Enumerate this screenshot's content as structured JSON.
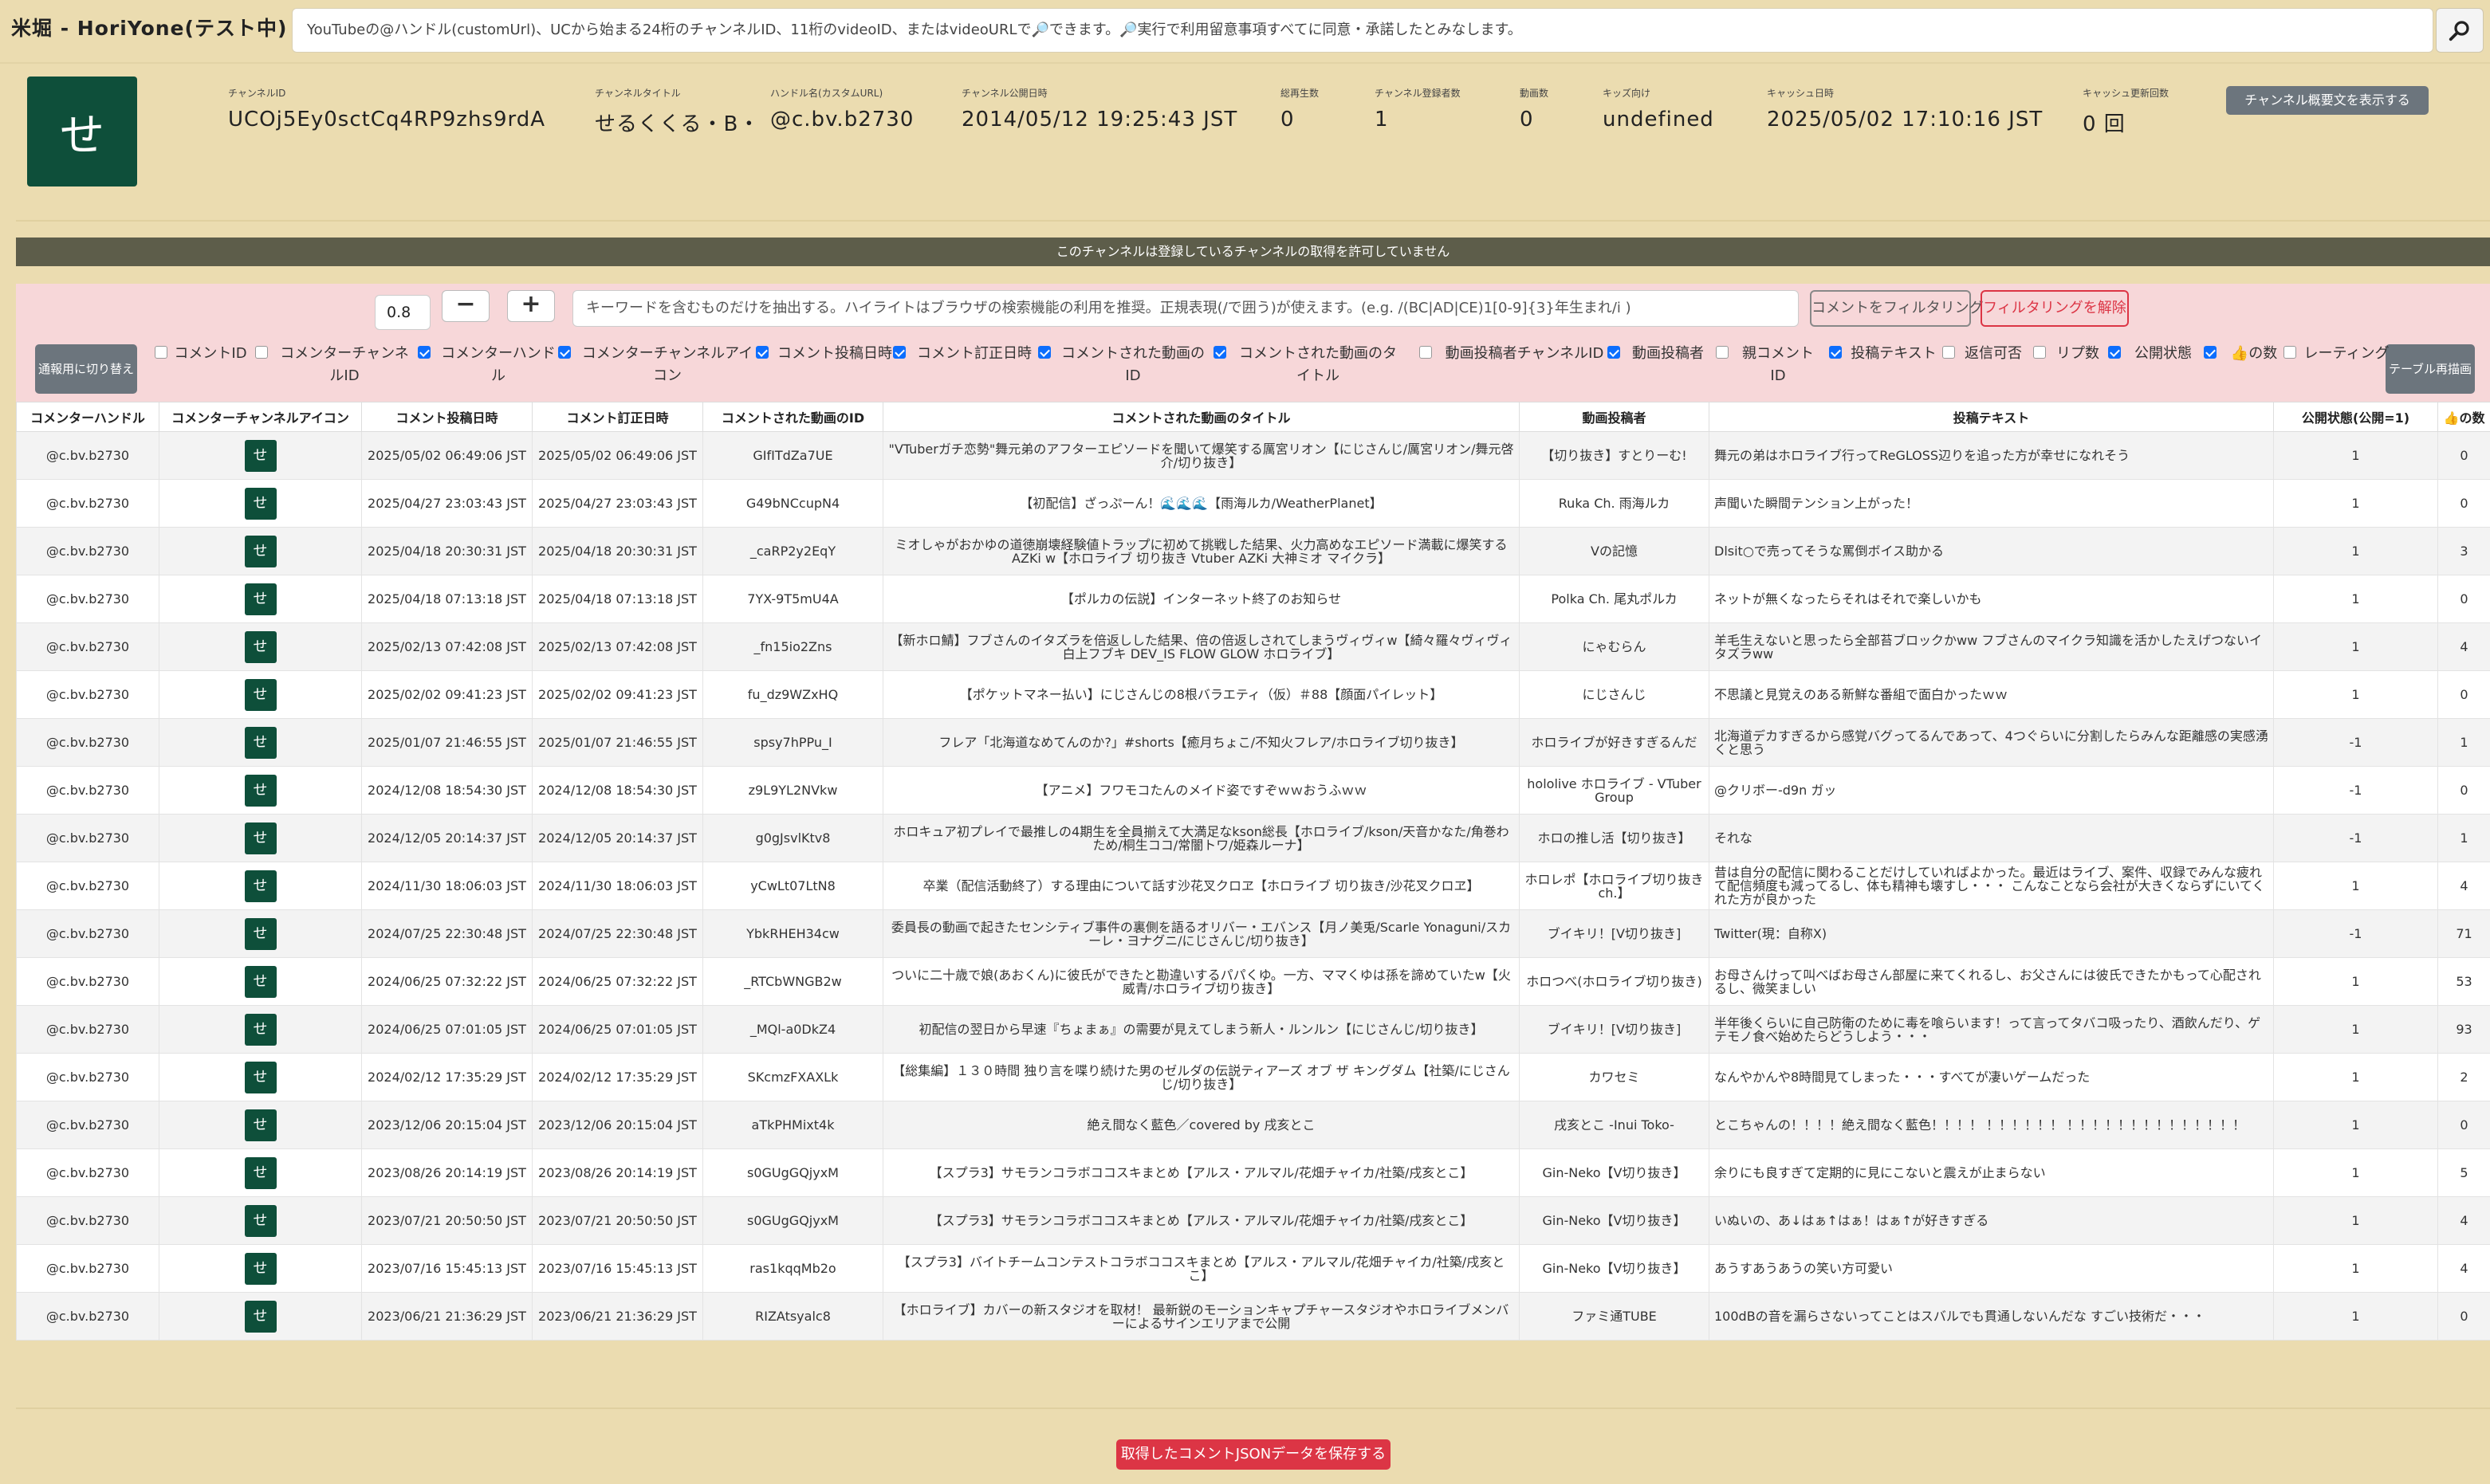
{
  "app": {
    "title": "米堀 - HoriYone(テスト中)",
    "search_placeholder": "YouTubeの@ハンドル(customUrl)、UCから始まる24桁のチャンネルID、11桁のvideoID、またはvideoURLで🔎できます。🔎実行で利用留意事項すべてに同意・承諾したとみなします。"
  },
  "channel": {
    "avatar_char": "せ",
    "fields": [
      {
        "label": "チャンネルID",
        "value": "UCOj5Ey0sctCq4RP9zhs9rdA"
      },
      {
        "label": "チャンネルタイトル",
        "value": "せるくくる・B・"
      },
      {
        "label": "ハンドル名(カスタムURL)",
        "value": "@c.bv.b2730"
      },
      {
        "label": "チャンネル公開日時",
        "value": "2014/05/12 19:25:43 JST"
      },
      {
        "label": "総再生数",
        "value": "0"
      },
      {
        "label": "チャンネル登録者数",
        "value": "1"
      },
      {
        "label": "動画数",
        "value": "0"
      },
      {
        "label": "キッズ向け",
        "value": "undefined"
      },
      {
        "label": "キャッシュ日時",
        "value": "2025/05/02 17:10:16 JST"
      },
      {
        "label": "キャッシュ更新回数",
        "value": "0 回"
      }
    ],
    "show_description_button": "チャンネル概要文を表示する"
  },
  "notice": "このチャンネルは登録しているチャンネルの取得を許可していません",
  "filter": {
    "opacity_value": "0.8",
    "minus": "−",
    "plus": "+",
    "keyword_placeholder": "キーワードを含むものだけを抽出する。ハイライトはブラウザの検索機能の利用を推奨。正規表現(/で囲う)が使えます。(e.g. /(BC|AD|CE)1[0-9]{3}年生まれ/i )",
    "filter_button": "コメントをフィルタリング",
    "unfilter_button": "フィルタリングを解除",
    "toggle_button": "通報用に切り替え",
    "redraw_button": "テーブル再描画",
    "columns": [
      {
        "label": "コメントID",
        "checked": false
      },
      {
        "label": "コメンターチャンネルID",
        "checked": false
      },
      {
        "label": "コメンターハンドル",
        "checked": true
      },
      {
        "label": "コメンターチャンネルアイコン",
        "checked": true
      },
      {
        "label": "コメント投稿日時",
        "checked": true
      },
      {
        "label": "コメント訂正日時",
        "checked": true
      },
      {
        "label": "コメントされた動画のID",
        "checked": true
      },
      {
        "label": "コメントされた動画のタイトル",
        "checked": true
      },
      {
        "label": "動画投稿者チャンネルID",
        "checked": false
      },
      {
        "label": "動画投稿者",
        "checked": true
      },
      {
        "label": "親コメントID",
        "checked": false
      },
      {
        "label": "投稿テキスト",
        "checked": true
      },
      {
        "label": "返信可否",
        "checked": false
      },
      {
        "label": "リプ数",
        "checked": false
      },
      {
        "label": "公開状態",
        "checked": true
      },
      {
        "label": "👍の数",
        "checked": true
      },
      {
        "label": "レーティング",
        "checked": false
      }
    ]
  },
  "table": {
    "headers": [
      "コメンターハンドル",
      "コメンターチャンネルアイコン",
      "コメント投稿日時",
      "コメント訂正日時",
      "コメントされた動画のID",
      "コメントされた動画のタイトル",
      "動画投稿者",
      "投稿テキスト",
      "公開状態(公開=1)",
      "👍の数"
    ],
    "rows": [
      {
        "handle": "@c.bv.b2730",
        "icon": "せ",
        "posted": "2025/05/02 06:49:06 JST",
        "edited": "2025/05/02 06:49:06 JST",
        "video_id": "GIfITdZa7UE",
        "title": "\"VTuberガチ恋勢\"舞元弟のアフターエピソードを聞いて爆笑する厲宮リオン【にじさんじ/厲宮リオン/舞元啓介/切り抜き】",
        "uploader": "【切り抜き】すとりーむ!",
        "text": "舞元の弟はホロライブ行ってReGLOSS辺りを追った方が幸せになれそう",
        "status": "1",
        "likes": "0"
      },
      {
        "handle": "@c.bv.b2730",
        "icon": "せ",
        "posted": "2025/04/27 23:03:43 JST",
        "edited": "2025/04/27 23:03:43 JST",
        "video_id": "G49bNCcupN4",
        "title": "【初配信】ざっぷーん！🌊🌊🌊【雨海ルカ/WeatherPlanet】",
        "uploader": "Ruka Ch. 雨海ルカ",
        "text": "声聞いた瞬間テンション上がった！",
        "status": "1",
        "likes": "0"
      },
      {
        "handle": "@c.bv.b2730",
        "icon": "せ",
        "posted": "2025/04/18 20:30:31 JST",
        "edited": "2025/04/18 20:30:31 JST",
        "video_id": "_caRP2y2EqY",
        "title": "ミオしゃがおかゆの道徳崩壊経験値トラップに初めて挑戦した結果、火力高めなエピソード満載に爆笑するAZKi w【ホロライブ 切り抜き Vtuber AZKi 大神ミオ マイクラ】",
        "uploader": "Vの記憶",
        "text": "Dlsit○で売ってそうな罵倒ボイス助かる",
        "status": "1",
        "likes": "3"
      },
      {
        "handle": "@c.bv.b2730",
        "icon": "せ",
        "posted": "2025/04/18 07:13:18 JST",
        "edited": "2025/04/18 07:13:18 JST",
        "video_id": "7YX-9T5mU4A",
        "title": "【ポルカの伝説】インターネット終了のお知らせ",
        "uploader": "Polka Ch. 尾丸ポルカ",
        "text": "ネットが無くなったらそれはそれで楽しいかも",
        "status": "1",
        "likes": "0"
      },
      {
        "handle": "@c.bv.b2730",
        "icon": "せ",
        "posted": "2025/02/13 07:42:08 JST",
        "edited": "2025/02/13 07:42:08 JST",
        "video_id": "_fn15io2Zns",
        "title": "【新ホロ鯖】フブさんのイタズラを倍返しした結果、倍の倍返しされてしまうヴィヴィw【綺々羅々ヴィヴィ 白上フブキ DEV_IS FLOW GLOW ホロライブ】",
        "uploader": "にゃむらん",
        "text": "羊毛生えないと思ったら全部苔ブロックかww フブさんのマイクラ知識を活かしたえげつないイタズラww",
        "status": "1",
        "likes": "4"
      },
      {
        "handle": "@c.bv.b2730",
        "icon": "せ",
        "posted": "2025/02/02 09:41:23 JST",
        "edited": "2025/02/02 09:41:23 JST",
        "video_id": "fu_dz9WZxHQ",
        "title": "【ポケットマネー払い】にじさんじの8根バラエティ（仮）＃88【顔面パイレット】",
        "uploader": "にじさんじ",
        "text": "不思議と見覚えのある新鮮な番組で面白かったｗｗ",
        "status": "1",
        "likes": "0"
      },
      {
        "handle": "@c.bv.b2730",
        "icon": "せ",
        "posted": "2025/01/07 21:46:55 JST",
        "edited": "2025/01/07 21:46:55 JST",
        "video_id": "spsy7hPPu_I",
        "title": "フレア「北海道なめてんのか?」#shorts【癒月ちょこ/不知火フレア/ホロライブ切り抜き】",
        "uploader": "ホロライブが好きすぎるんだ",
        "text": "北海道デカすぎるから感覚バグってるんであって、4つぐらいに分割したらみんな距離感の実感湧くと思う",
        "status": "-1",
        "likes": "1"
      },
      {
        "handle": "@c.bv.b2730",
        "icon": "せ",
        "posted": "2024/12/08 18:54:30 JST",
        "edited": "2024/12/08 18:54:30 JST",
        "video_id": "z9L9YL2NVkw",
        "title": "【アニメ】フワモコたんのメイド姿ですぞｗｗおうふｗｗ",
        "uploader": "hololive ホロライブ - VTuber Group",
        "text": "@クリボー-d9n ガッ",
        "status": "-1",
        "likes": "0"
      },
      {
        "handle": "@c.bv.b2730",
        "icon": "せ",
        "posted": "2024/12/05 20:14:37 JST",
        "edited": "2024/12/05 20:14:37 JST",
        "video_id": "g0gJsvlKtv8",
        "title": "ホロキュア初プレイで最推しの4期生を全員揃えて大満足なkson総長【ホロライブ/kson/天音かなた/角巻わため/桐生ココ/常闇トワ/姫森ルーナ】",
        "uploader": "ホロの推し活【切り抜き】",
        "text": "それな",
        "status": "-1",
        "likes": "1"
      },
      {
        "handle": "@c.bv.b2730",
        "icon": "せ",
        "posted": "2024/11/30 18:06:03 JST",
        "edited": "2024/11/30 18:06:03 JST",
        "video_id": "yCwLt07LtN8",
        "title": "卒業（配信活動終了）する理由について話す沙花叉クロヱ【ホロライブ 切り抜き/沙花叉クロヱ】",
        "uploader": "ホロレポ【ホロライブ切り抜きch.】",
        "text": "昔は自分の配信に関わることだけしていればよかった。最近はライブ、案件、収録でみんな疲れて配信頻度も減ってるし、体も精神も壊すし・・・ こんなことなら会社が大きくならずにいてくれた方が良かった",
        "status": "1",
        "likes": "4"
      },
      {
        "handle": "@c.bv.b2730",
        "icon": "せ",
        "posted": "2024/07/25 22:30:48 JST",
        "edited": "2024/07/25 22:30:48 JST",
        "video_id": "YbkRHEH34cw",
        "title": "委員長の動画で起きたセンシティブ事件の裏側を語るオリバー・エバンス【月ノ美兎/Scarle Yonaguni/スカーレ・ヨナグニ/にじさんじ/切り抜き】",
        "uploader": "ブイキリ！[V切り抜き]",
        "text": "Twitter(現：自称X)",
        "status": "-1",
        "likes": "71"
      },
      {
        "handle": "@c.bv.b2730",
        "icon": "せ",
        "posted": "2024/06/25 07:32:22 JST",
        "edited": "2024/06/25 07:32:22 JST",
        "video_id": "_RTCbWNGB2w",
        "title": "ついに二十歳で娘(あおくん)に彼氏ができたと勘違いするパパくゆ。一方、ママくゆは孫を諦めていたw【火威青/ホロライブ切り抜き】",
        "uploader": "ホロつべ(ホロライブ切り抜き)",
        "text": "お母さんけって叫べばお母さん部屋に来てくれるし、お父さんには彼氏できたかもって心配されるし、微笑ましい",
        "status": "1",
        "likes": "53"
      },
      {
        "handle": "@c.bv.b2730",
        "icon": "せ",
        "posted": "2024/06/25 07:01:05 JST",
        "edited": "2024/06/25 07:01:05 JST",
        "video_id": "_MQl-a0DkZ4",
        "title": "初配信の翌日から早速『ちょまぁ』の需要が見えてしまう新人・ルンルン【にじさんじ/切り抜き】",
        "uploader": "ブイキリ！[V切り抜き]",
        "text": "半年後くらいに自己防衛のために毒を喰らいます！って言ってタバコ吸ったり、酒飲んだり、ゲテモノ食べ始めたらどうしよう・・・",
        "status": "1",
        "likes": "93"
      },
      {
        "handle": "@c.bv.b2730",
        "icon": "せ",
        "posted": "2024/02/12 17:35:29 JST",
        "edited": "2024/02/12 17:35:29 JST",
        "video_id": "SKcmzFXAXLk",
        "title": "【総集編】１３０時間 独り言を喋り続けた男のゼルダの伝説ティアーズ オブ ザ キングダム【社築/にじさんじ/切り抜き】",
        "uploader": "カワセミ",
        "text": "なんやかんや8時間見てしまった・・・すべてが凄いゲームだった",
        "status": "1",
        "likes": "2"
      },
      {
        "handle": "@c.bv.b2730",
        "icon": "せ",
        "posted": "2023/12/06 20:15:04 JST",
        "edited": "2023/12/06 20:15:04 JST",
        "video_id": "aTkPHMixt4k",
        "title": "絶え間なく藍色／covered by 戌亥とこ",
        "uploader": "戌亥とこ -Inui Toko-",
        "text": "とこちゃんの！！！！絶え間なく藍色！！！！ ！！！！！！ ！！！！！！！！！！！！！！",
        "status": "1",
        "likes": "0"
      },
      {
        "handle": "@c.bv.b2730",
        "icon": "せ",
        "posted": "2023/08/26 20:14:19 JST",
        "edited": "2023/08/26 20:14:19 JST",
        "video_id": "s0GUgGQjyxM",
        "title": "【スプラ3】サモランコラボココスキまとめ【アルス・アルマル/花畑チャイカ/社築/戌亥とこ】",
        "uploader": "Gin-Neko【V切り抜き】",
        "text": "余りにも良すぎて定期的に見にこないと震えが止まらない",
        "status": "1",
        "likes": "5"
      },
      {
        "handle": "@c.bv.b2730",
        "icon": "せ",
        "posted": "2023/07/21 20:50:50 JST",
        "edited": "2023/07/21 20:50:50 JST",
        "video_id": "s0GUgGQjyxM",
        "title": "【スプラ3】サモランコラボココスキまとめ【アルス・アルマル/花畑チャイカ/社築/戌亥とこ】",
        "uploader": "Gin-Neko【V切り抜き】",
        "text": "いぬいの、あ↓はぁ↑はぁ！はぁ↑が好きすぎる",
        "status": "1",
        "likes": "4"
      },
      {
        "handle": "@c.bv.b2730",
        "icon": "せ",
        "posted": "2023/07/16 15:45:13 JST",
        "edited": "2023/07/16 15:45:13 JST",
        "video_id": "ras1kqqMb2o",
        "title": "【スプラ3】バイトチームコンテストコラボココスキまとめ【アルス・アルマル/花畑チャイカ/社築/戌亥とこ】",
        "uploader": "Gin-Neko【V切り抜き】",
        "text": "あうすあうあうの笑い方可愛い",
        "status": "1",
        "likes": "4"
      },
      {
        "handle": "@c.bv.b2730",
        "icon": "せ",
        "posted": "2023/06/21 21:36:29 JST",
        "edited": "2023/06/21 21:36:29 JST",
        "video_id": "RIZAtsyalc8",
        "title": "【ホロライブ】カバーの新スタジオを取材！ 最新鋭のモーションキャプチャースタジオやホロライブメンバーによるサインエリアまで公開",
        "uploader": "ファミ通TUBE",
        "text": "100dBの音を漏らさないってことはスバルでも貫通しないんだな すごい技術だ・・・",
        "status": "1",
        "likes": "0"
      }
    ]
  },
  "footer": {
    "save_button": "取得したコメントJSONデータを保存する"
  }
}
